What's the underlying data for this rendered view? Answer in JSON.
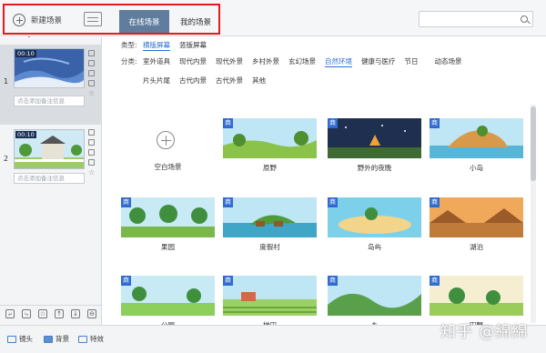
{
  "toolbar": {
    "new_scene_label": "新建场景",
    "tabs": [
      "在线场景",
      "我的场景"
    ],
    "search_placeholder": ""
  },
  "filters": {
    "type_label": "类型:",
    "types": [
      "横版屏幕",
      "竖版屏幕"
    ],
    "active_type": "横版屏幕",
    "category_label": "分类:",
    "categories_row1": [
      "室外道具",
      "现代内景",
      "现代外景",
      "乡村外景",
      "玄幻场景",
      "自然环境",
      "健康与医疗",
      "节日",
      "动态场景"
    ],
    "categories_row2": [
      "片头片尾",
      "古代内景",
      "古代外景",
      "其他"
    ],
    "active_category": "自然环境"
  },
  "slides": [
    {
      "number": "1",
      "time": "00:10",
      "note": "点击添加备注信息",
      "active": true
    },
    {
      "number": "2",
      "time": "00:10",
      "note": "点击添加备注信息",
      "active": false
    }
  ],
  "add_slide_symbol": "+",
  "left_tools": [
    "⤶",
    "⤷",
    "☆",
    "↑",
    "↓",
    "⊖"
  ],
  "scene_badge": "商",
  "blank_scene_label": "空白场景",
  "scenes_row1": [
    "原野",
    "野外的夜晚",
    "小岛"
  ],
  "scenes_row2": [
    "果园",
    "度假村",
    "岛屿",
    "湖泊"
  ],
  "scenes_row3": [
    "公园",
    "梯田",
    "乡",
    "田野"
  ],
  "bottom": {
    "camera_label": "镜头",
    "background_label": "背景",
    "effect_label": "特效"
  },
  "watermark": "知乎 @綿綿"
}
